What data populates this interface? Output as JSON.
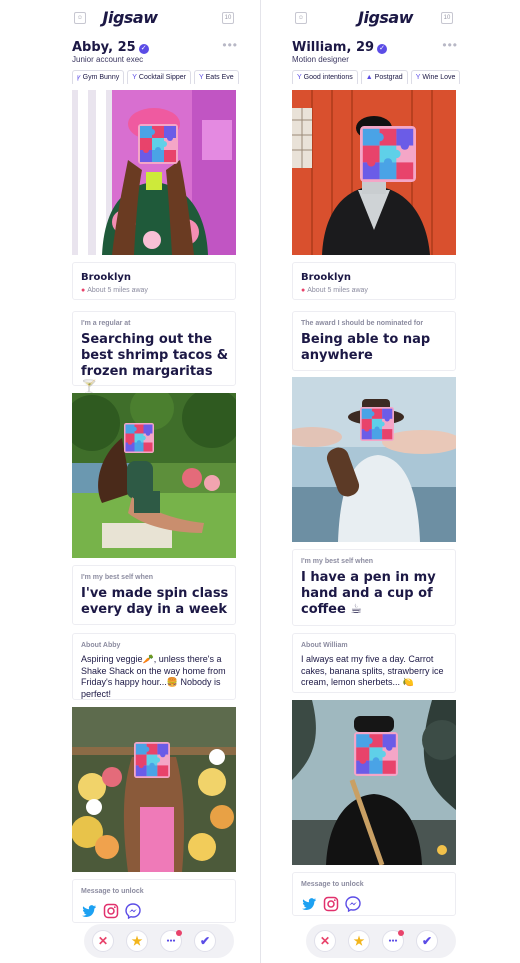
{
  "app": {
    "logo": "Jigsaw"
  },
  "colors": {
    "accent": "#5b4ce6",
    "ink": "#1c1845",
    "pin": "#e8436b",
    "muted": "#8c8ca0"
  },
  "profiles": [
    {
      "name": "Abby, 25",
      "job": "Junior account exec",
      "chips": [
        {
          "icon": "glass-icon",
          "label": "Gym Bunny"
        },
        {
          "icon": "cocktail-icon",
          "label": "Cocktail Sipper"
        },
        {
          "icon": "glass-icon",
          "label": "Eats Eve"
        }
      ],
      "location": {
        "city": "Brooklyn",
        "distance": "About 5 miles away"
      },
      "prompt1": {
        "label": "I'm a regular at",
        "answer": "Searching out the best shrimp tacos & frozen margaritas 🍸"
      },
      "prompt2": {
        "label": "I'm my best self when",
        "answer": "I've made spin class every day in a week"
      },
      "about": {
        "label": "About Abby",
        "text": "Aspiring veggie🥕, unless there's a Shake Shack on the way home from Friday's happy hour...🍔 Nobody is perfect!"
      },
      "unlock": {
        "label": "Message to unlock",
        "socials": [
          "twitter-icon",
          "instagram-icon",
          "messenger-icon"
        ]
      }
    },
    {
      "name": "William, 29",
      "job": "Motion designer",
      "chips": [
        {
          "icon": "glass-icon",
          "label": "Good intentions"
        },
        {
          "icon": "graduation-cap-icon",
          "label": "Postgrad"
        },
        {
          "icon": "glass-icon",
          "label": "Wine Love"
        }
      ],
      "location": {
        "city": "Brooklyn",
        "distance": "About 5 miles away"
      },
      "prompt1": {
        "label": "The award I should be nominated for",
        "answer": "Being able to nap anywhere"
      },
      "prompt2": {
        "label": "I'm my best self when",
        "answer": "I have a pen in my hand and a cup of coffee ☕"
      },
      "about": {
        "label": "About William",
        "text": "I always eat my five a day. Carrot cakes, banana splits, strawberry ice cream, lemon sherbets... 🍋"
      },
      "unlock": {
        "label": "Message to unlock",
        "socials": [
          "twitter-icon",
          "instagram-icon",
          "messenger-icon"
        ]
      }
    }
  ],
  "actions": [
    {
      "icon": "close-icon",
      "glyph": "✕"
    },
    {
      "icon": "star-icon",
      "glyph": "★"
    },
    {
      "icon": "message-icon",
      "glyph": "●●●"
    },
    {
      "icon": "check-icon",
      "glyph": "✔"
    }
  ]
}
